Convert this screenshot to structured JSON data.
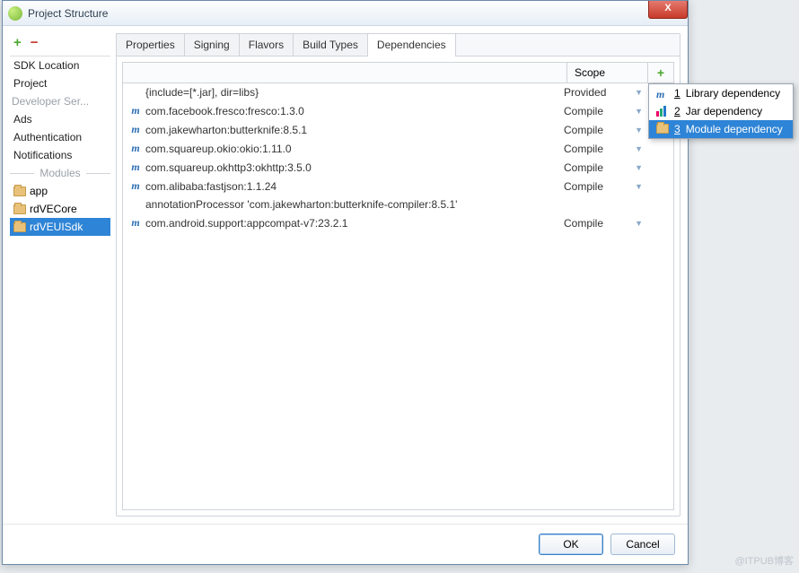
{
  "window": {
    "title": "Project Structure",
    "close": "X"
  },
  "sidebar": {
    "items": [
      "SDK Location",
      "Project"
    ],
    "dev_header": "Developer Ser...",
    "dev_items": [
      "Ads",
      "Authentication",
      "Notifications"
    ],
    "modules_header": "Modules",
    "modules": [
      "app",
      "rdVECore",
      "rdVEUISdk"
    ],
    "selected_module": "rdVEUISdk"
  },
  "tabs": {
    "items": [
      "Properties",
      "Signing",
      "Flavors",
      "Build Types",
      "Dependencies"
    ],
    "active": "Dependencies"
  },
  "grid": {
    "headers": {
      "name": "",
      "scope": "Scope"
    },
    "rows": [
      {
        "icon": "",
        "name": "{include=[*.jar], dir=libs}",
        "scope": "Provided"
      },
      {
        "icon": "m",
        "name": "com.facebook.fresco:fresco:1.3.0",
        "scope": "Compile"
      },
      {
        "icon": "m",
        "name": "com.jakewharton:butterknife:8.5.1",
        "scope": "Compile"
      },
      {
        "icon": "m",
        "name": "com.squareup.okio:okio:1.11.0",
        "scope": "Compile"
      },
      {
        "icon": "m",
        "name": "com.squareup.okhttp3:okhttp:3.5.0",
        "scope": "Compile"
      },
      {
        "icon": "m",
        "name": "com.alibaba:fastjson:1.1.24",
        "scope": "Compile"
      },
      {
        "icon": "",
        "name": "annotationProcessor 'com.jakewharton:butterknife-compiler:8.5.1'",
        "scope": ""
      },
      {
        "icon": "m",
        "name": "com.android.support:appcompat-v7:23.2.1",
        "scope": "Compile"
      }
    ]
  },
  "popup": {
    "items": [
      {
        "num": "1",
        "label": "Library dependency",
        "icon": "lib"
      },
      {
        "num": "2",
        "label": "Jar dependency",
        "icon": "jar"
      },
      {
        "num": "3",
        "label": "Module dependency",
        "icon": "folder",
        "selected": true
      }
    ]
  },
  "footer": {
    "ok": "OK",
    "cancel": "Cancel"
  },
  "watermark": "@ITPUB博客"
}
